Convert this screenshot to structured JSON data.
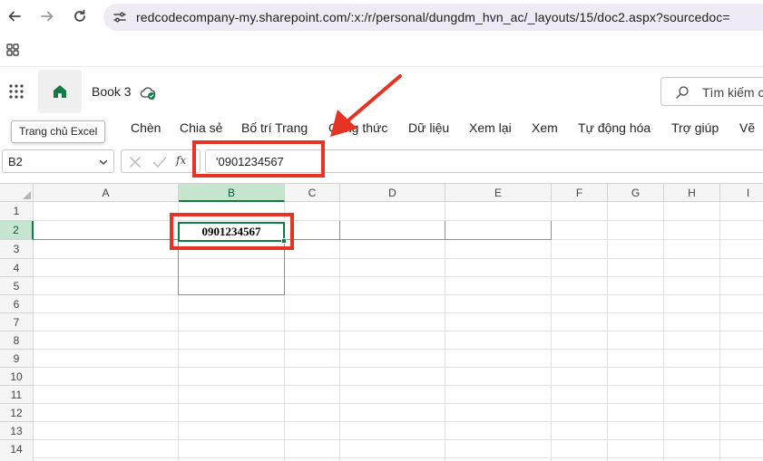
{
  "browser": {
    "url": "redcodecompany-my.sharepoint.com/:x:/r/personal/dungdm_hvn_ac/_layouts/15/doc2.aspx?sourcedoc="
  },
  "excel": {
    "book_title": "Book 3",
    "search_placeholder": "Tìm kiếm c",
    "tooltip": "Trang chủ Excel",
    "ribbon_tabs": [
      "Chèn",
      "Chia sẻ",
      "Bố trí Trang",
      "Công thức",
      "Dữ liệu",
      "Xem lại",
      "Xem",
      "Tự động hóa",
      "Trợ giúp",
      "Vẽ"
    ],
    "name_box": "B2",
    "fx_label": "fx",
    "formula_value": "'0901234567",
    "columns": [
      "A",
      "B",
      "C",
      "D",
      "E",
      "F",
      "G",
      "H",
      "I"
    ],
    "rows": [
      "1",
      "2",
      "3",
      "4",
      "5",
      "6",
      "7",
      "8",
      "9",
      "10",
      "11",
      "12",
      "13",
      "14"
    ],
    "selected_cell": "B2",
    "selected_cell_value": "0901234567",
    "accent_color": "#107c41",
    "annotation_color": "#e63323"
  }
}
